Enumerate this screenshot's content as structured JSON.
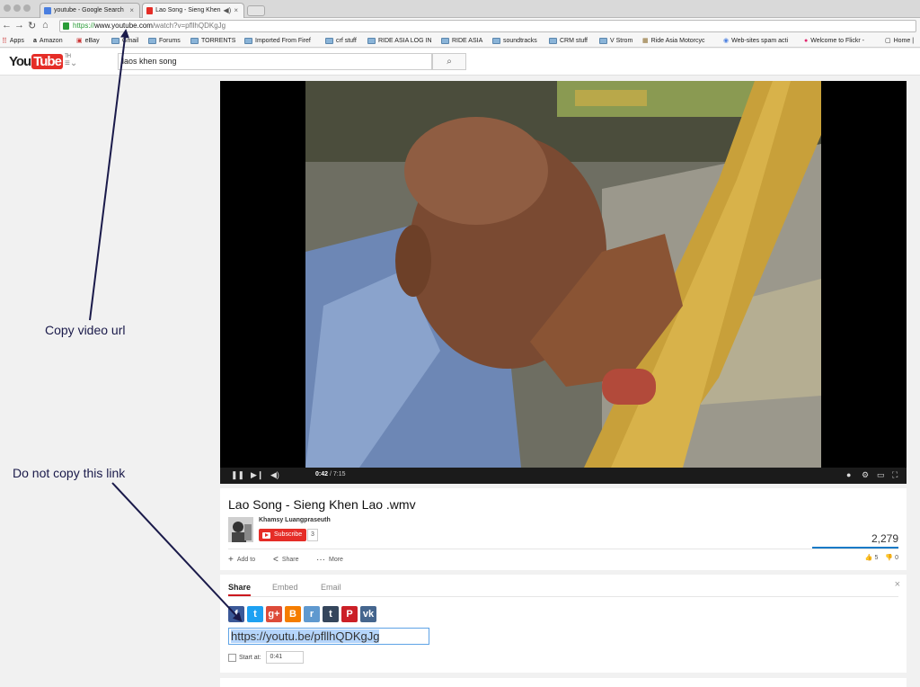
{
  "browser": {
    "tabs": [
      {
        "title": "youtube - Google Search",
        "active": false
      },
      {
        "title": "Lao Song - Sieng Khen",
        "active": true
      }
    ],
    "url": {
      "scheme": "https://",
      "domain": "www.youtube.com",
      "path": "/watch?v=pfllhQDKgJg"
    },
    "bookmarks": [
      "Apps",
      "Amazon",
      "eBay",
      "Gmail",
      "Forums",
      "TORRENTS",
      "Imported From Firef",
      "crf stuff",
      "RIDE ASIA LOG IN",
      "RIDE ASIA",
      "soundtracks",
      "CRM stuff",
      "V Strom",
      "Ride Asia Motorcyc",
      "Web-sites spam acti",
      "Welcome to Flickr -",
      "Home |"
    ]
  },
  "youtube": {
    "logo_you": "You",
    "logo_tube": "Tube",
    "logo_country": "TH",
    "search_value": "laos khen song",
    "search_icon": "magnifier-icon"
  },
  "player": {
    "time_current": "0:42",
    "time_total": "/ 7:15",
    "progress_fraction": 0.097
  },
  "video": {
    "title": "Lao Song - Sieng Khen Lao .wmv",
    "channel": "Khamsy Luangpraseuth",
    "subscribe_label": "Subscribe",
    "subscriber_count": "3",
    "views": "2,279",
    "actions": {
      "add_to": "Add to",
      "share": "Share",
      "more": "More"
    },
    "likes": "5",
    "dislikes": "0"
  },
  "share": {
    "tabs": [
      "Share",
      "Embed",
      "Email"
    ],
    "close": "×",
    "networks": [
      {
        "name": "facebook-icon",
        "glyph": "f",
        "color": "#3b5998"
      },
      {
        "name": "twitter-icon",
        "glyph": "t",
        "color": "#1da1f2"
      },
      {
        "name": "google-plus-icon",
        "glyph": "g+",
        "color": "#dd4b39"
      },
      {
        "name": "blogger-icon",
        "glyph": "B",
        "color": "#f57d00"
      },
      {
        "name": "reddit-icon",
        "glyph": "r",
        "color": "#5f99cf"
      },
      {
        "name": "tumblr-icon",
        "glyph": "t",
        "color": "#35465c"
      },
      {
        "name": "pinterest-icon",
        "glyph": "P",
        "color": "#cb2027"
      },
      {
        "name": "vk-icon",
        "glyph": "vk",
        "color": "#45668e"
      }
    ],
    "short_url": "https://youtu.be/pfllhQDKgJg",
    "start_at_label": "Start at:",
    "start_at_value": "0:41"
  },
  "annotations": {
    "copy_video_url": "Copy  video url",
    "do_not_copy": "Do not copy this link"
  }
}
